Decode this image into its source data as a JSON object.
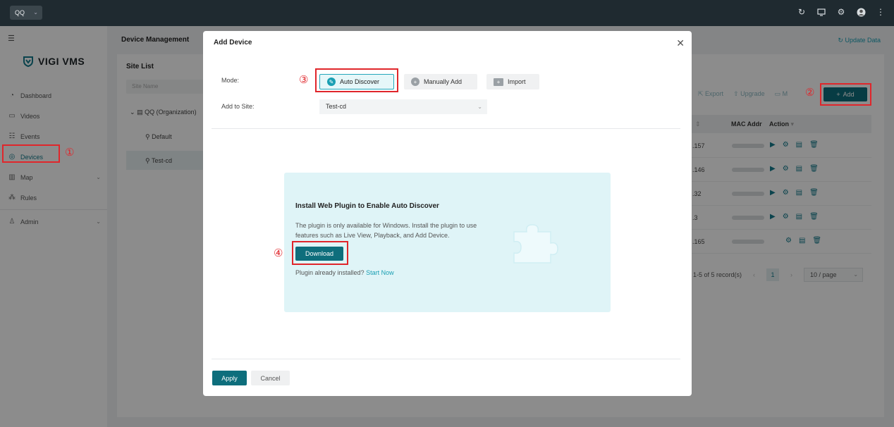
{
  "topbar": {
    "org_select": "QQ",
    "icons": [
      "refresh-icon",
      "monitor-icon",
      "gear-icon",
      "avatar",
      "more-icon"
    ]
  },
  "sidebar": {
    "logo_text": "VIGI VMS",
    "items": [
      {
        "label": "Dashboard",
        "icon": "dashboard-icon"
      },
      {
        "label": "Videos",
        "icon": "video-icon"
      },
      {
        "label": "Events",
        "icon": "events-icon"
      },
      {
        "label": "Devices",
        "icon": "devices-icon",
        "active": true
      },
      {
        "label": "Map",
        "icon": "map-icon",
        "expandable": true
      },
      {
        "label": "Rules",
        "icon": "rules-icon"
      },
      {
        "label": "Admin",
        "icon": "admin-icon",
        "expandable": true
      }
    ]
  },
  "main": {
    "page_title": "Device Management",
    "update_data": "Update Data",
    "site_list": {
      "title": "Site List",
      "search_placeholder": "Site Name",
      "org": "QQ (Organization)",
      "sites": [
        "Default",
        "Test-cd"
      ]
    },
    "toolbar": {
      "export": "Export",
      "upgrade": "Upgrade",
      "more": "M",
      "add": "Add"
    },
    "table": {
      "headers": [
        "MAC Addr",
        "Action"
      ],
      "rows": [
        {
          "ip": ".157"
        },
        {
          "ip": ".146"
        },
        {
          "ip": ".32"
        },
        {
          "ip": ".3"
        },
        {
          "ip": ".165"
        }
      ]
    },
    "pagination": {
      "summary": "1-5 of 5 record(s)",
      "page": "1",
      "per_page": "10 / page"
    }
  },
  "annotations": {
    "n1": "①",
    "n2": "②",
    "n3": "③",
    "n4": "④",
    "color": "#e0262b"
  },
  "modal": {
    "title": "Add Device",
    "mode_label": "Mode:",
    "add_to_site_label": "Add to Site:",
    "modes": {
      "auto": "Auto Discover",
      "manual": "Manually Add",
      "import": "Import"
    },
    "site_value": "Test-cd",
    "plugin": {
      "title": "Install Web Plugin to Enable Auto Discover",
      "desc": "The plugin is only available for Windows. Install the plugin to use features such as Live View, Playback, and Add Device.",
      "download": "Download",
      "installed_text": "Plugin already installed?",
      "start_now": "Start Now"
    },
    "apply": "Apply",
    "cancel": "Cancel"
  }
}
